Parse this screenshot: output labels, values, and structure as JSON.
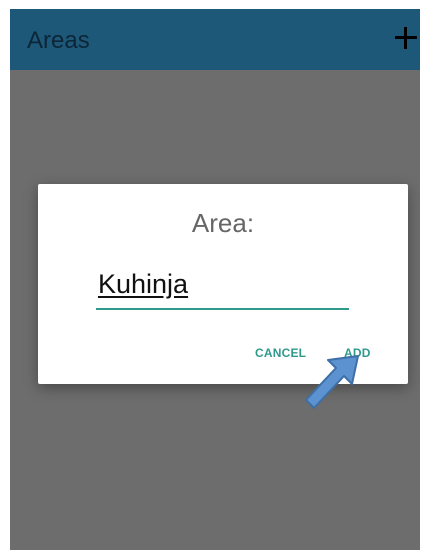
{
  "appbar": {
    "title": "Areas",
    "add_icon": "plus-icon"
  },
  "dialog": {
    "title": "Area:",
    "input_value": "Kuhinja",
    "cancel_label": "CANCEL",
    "add_label": "ADD"
  },
  "annotation": {
    "icon": "pointer-arrow-icon"
  },
  "colors": {
    "appbar": "#1d5878",
    "scrim": "#6d6d6d",
    "accent": "#2f9a8c",
    "arrow": "#5b92cf"
  }
}
